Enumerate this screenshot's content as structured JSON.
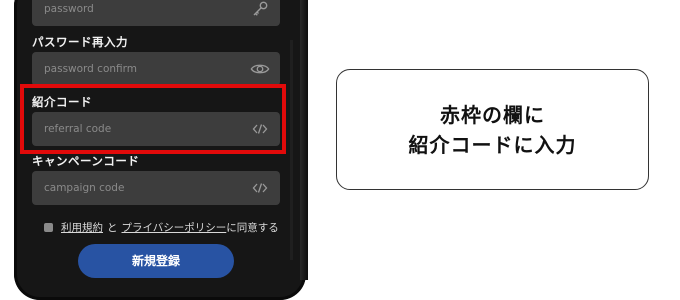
{
  "form": {
    "password": {
      "placeholder": "password",
      "icon": "key-icon"
    },
    "password_confirm": {
      "label": "パスワード再入力",
      "placeholder": "password confirm",
      "icon": "eye-icon"
    },
    "referral": {
      "label": "紹介コード",
      "placeholder": "referral code",
      "icon": "code-icon"
    },
    "campaign": {
      "label": "キャンペーンコード",
      "placeholder": "campaign code",
      "icon": "code-icon"
    },
    "agreement": {
      "terms_link": "利用規約",
      "connector": "と",
      "privacy_link": "プライバシーポリシー",
      "suffix": "に同意する"
    },
    "submit_label": "新規登録"
  },
  "callout": {
    "line1": "赤枠の欄に",
    "line2": "紹介コードに入力"
  },
  "colors": {
    "highlight_border": "#e10a0a",
    "submit_button": "#2853a3",
    "field_background": "#3d3d3d",
    "phone_background": "#161616"
  }
}
